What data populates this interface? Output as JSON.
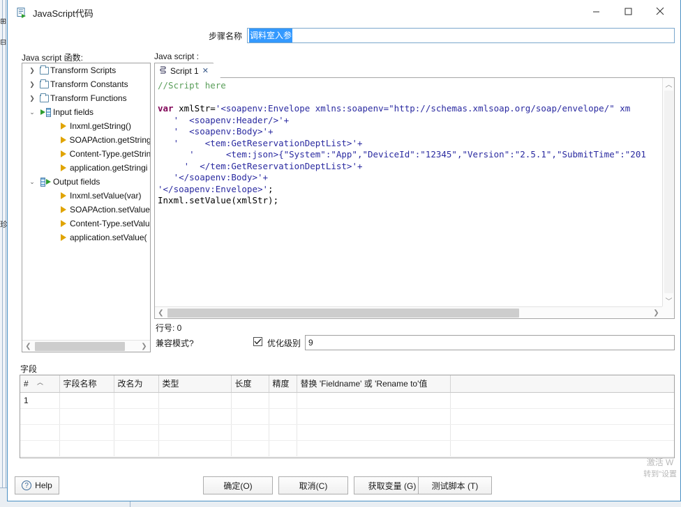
{
  "window": {
    "title": "JavaScript代码",
    "icon": "script-window-icon",
    "minimize_label": "minimize-icon",
    "maximize_label": "maximize-icon",
    "close_label": "close-icon"
  },
  "step": {
    "label": "步骤名称",
    "value": "调料室入参",
    "placeholder": ""
  },
  "panels": {
    "functions_label": "Java script 函数:",
    "script_label": "Java script :",
    "fields_label": "字段"
  },
  "tree": {
    "nodes": [
      {
        "label": "Transform Scripts",
        "depth": 1,
        "icon": "folder-icon",
        "expander": "chevron-right-icon"
      },
      {
        "label": "Transform Constants",
        "depth": 1,
        "icon": "folder-icon",
        "expander": "chevron-right-icon"
      },
      {
        "label": "Transform Functions",
        "depth": 1,
        "icon": "folder-icon",
        "expander": "chevron-right-icon"
      },
      {
        "label": "Input fields",
        "depth": 1,
        "icon": "input-fields-icon",
        "expander": "chevron-down-icon"
      },
      {
        "label": "Inxml.getString()",
        "depth": 2,
        "icon": "gold-arrow-icon",
        "expander": ""
      },
      {
        "label": "SOAPAction.getString",
        "depth": 2,
        "icon": "gold-arrow-icon",
        "expander": ""
      },
      {
        "label": "Content-Type.getStrin",
        "depth": 2,
        "icon": "gold-arrow-icon",
        "expander": ""
      },
      {
        "label": "application.getStringi",
        "depth": 2,
        "icon": "gold-arrow-icon",
        "expander": ""
      },
      {
        "label": "Output fields",
        "depth": 1,
        "icon": "output-fields-icon",
        "expander": "chevron-down-icon"
      },
      {
        "label": "Inxml.setValue(var)",
        "depth": 2,
        "icon": "gold-arrow-icon",
        "expander": ""
      },
      {
        "label": "SOAPAction.setValue",
        "depth": 2,
        "icon": "gold-arrow-icon",
        "expander": ""
      },
      {
        "label": "Content-Type.setValu",
        "depth": 2,
        "icon": "gold-arrow-icon",
        "expander": ""
      },
      {
        "label": "application.setValue(",
        "depth": 2,
        "icon": "gold-arrow-icon",
        "expander": ""
      }
    ]
  },
  "editor": {
    "tab": {
      "label": "Script 1",
      "icon": "script-tab-icon",
      "close_icon": "tab-close-icon"
    },
    "code_lines": [
      {
        "segments": [
          {
            "t": "//Script here",
            "c": "c-comment"
          }
        ]
      },
      {
        "segments": [
          {
            "t": "",
            "c": "c-plain"
          }
        ]
      },
      {
        "segments": [
          {
            "t": "var",
            "c": "c-kw"
          },
          {
            "t": " xmlStr=",
            "c": "c-plain"
          },
          {
            "t": "'<soapenv:Envelope xmlns:soapenv=\"http://schemas.xmlsoap.org/soap/envelope/\" xm",
            "c": "c-str"
          }
        ]
      },
      {
        "segments": [
          {
            "t": "   '  <soapenv:Header/>'+",
            "c": "c-str"
          }
        ]
      },
      {
        "segments": [
          {
            "t": "   '  <soapenv:Body>'+",
            "c": "c-str"
          }
        ]
      },
      {
        "segments": [
          {
            "t": "   '     <tem:GetReservationDeptList>'+",
            "c": "c-str"
          }
        ]
      },
      {
        "segments": [
          {
            "t": "      '      <tem:json>{\"System\":\"App\",\"DeviceId\":\"12345\",\"Version\":\"2.5.1\",\"SubmitTime\":\"201",
            "c": "c-str"
          }
        ]
      },
      {
        "segments": [
          {
            "t": "     '  </tem:GetReservationDeptList>'+",
            "c": "c-str"
          }
        ]
      },
      {
        "segments": [
          {
            "t": "   '</soapenv:Body>'+",
            "c": "c-str"
          }
        ]
      },
      {
        "segments": [
          {
            "t": "'</soapenv:Envelope>'",
            "c": "c-str"
          },
          {
            "t": ";",
            "c": "c-plain"
          }
        ]
      },
      {
        "segments": [
          {
            "t": "Inxml.setValue(xmlStr);",
            "c": "c-plain"
          }
        ]
      }
    ],
    "line_number_label": "行号: 0",
    "compat_label": "兼容模式?",
    "optimization_label": "优化级别",
    "optimization_value": "9",
    "optimization_checked": true,
    "scroll": {
      "v_up_icon": "scroll-up-icon",
      "v_down_icon": "scroll-down-icon",
      "h_left_icon": "scroll-left-icon",
      "h_right_icon": "scroll-right-icon"
    }
  },
  "tree_scroll": {
    "left_icon": "scroll-left-icon",
    "right_icon": "scroll-right-icon"
  },
  "fields_table": {
    "columns": [
      "#",
      "字段名称",
      "改名为",
      "类型",
      "长度",
      "精度",
      "替换 'Fieldname' 或 'Rename to'值"
    ],
    "rows": [
      {
        "num": "1",
        "name": "",
        "rename": "",
        "type": "",
        "length": "",
        "precision": "",
        "replace": ""
      },
      {
        "num": "",
        "name": "",
        "rename": "",
        "type": "",
        "length": "",
        "precision": "",
        "replace": ""
      },
      {
        "num": "",
        "name": "",
        "rename": "",
        "type": "",
        "length": "",
        "precision": "",
        "replace": ""
      },
      {
        "num": "",
        "name": "",
        "rename": "",
        "type": "",
        "length": "",
        "precision": "",
        "replace": ""
      }
    ]
  },
  "buttons": {
    "help": "Help",
    "ok": "确定(O)",
    "cancel": "取消(C)",
    "get_variables": "获取变量 (G)",
    "test_script": "测试脚本 (T)"
  },
  "watermark": {
    "line1": "激活 W",
    "line2": "转到\"设置"
  }
}
